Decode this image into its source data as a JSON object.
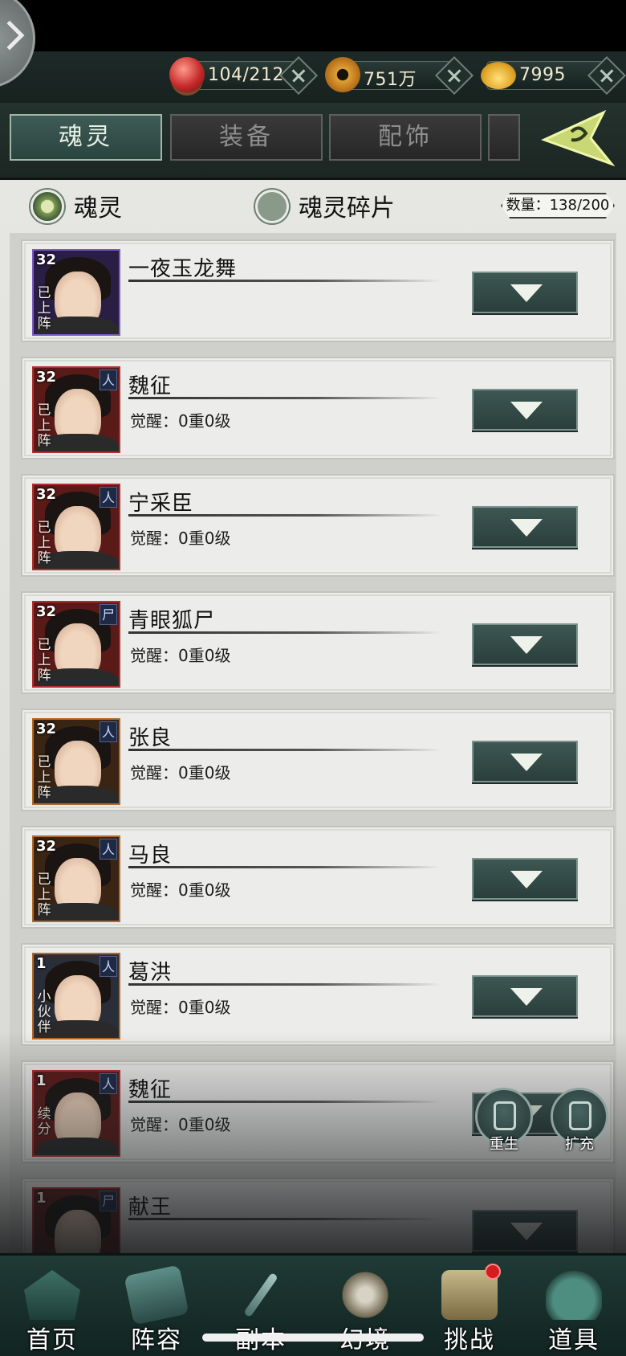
{
  "resources": [
    {
      "icon": "red-orb-icon",
      "value": "104/212"
    },
    {
      "icon": "copper-coin-icon",
      "value": "751万"
    },
    {
      "icon": "gold-ingot-icon",
      "value": "7995"
    }
  ],
  "tabs": [
    {
      "label": "魂灵",
      "active": true
    },
    {
      "label": "装备",
      "active": false
    },
    {
      "label": "配饰",
      "active": false
    }
  ],
  "filter": {
    "option_soul": "魂灵",
    "option_fragments": "魂灵碎片",
    "count": "数量：138/200"
  },
  "cards": [
    {
      "level": "32",
      "tag": "已上阵",
      "element": "",
      "name": "一夜玉龙舞",
      "awaken": "",
      "frame": "purple"
    },
    {
      "level": "32",
      "tag": "已上阵",
      "element": "人",
      "name": "魏征",
      "awaken": "觉醒：0重0级",
      "frame": "red"
    },
    {
      "level": "32",
      "tag": "已上阵",
      "element": "人",
      "name": "宁采臣",
      "awaken": "觉醒：0重0级",
      "frame": "red"
    },
    {
      "level": "32",
      "tag": "已上阵",
      "element": "尸",
      "name": "青眼狐尸",
      "awaken": "觉醒：0重0级",
      "frame": "red"
    },
    {
      "level": "32",
      "tag": "已上阵",
      "element": "人",
      "name": "张良",
      "awaken": "觉醒：0重0级",
      "frame": "orange"
    },
    {
      "level": "32",
      "tag": "已上阵",
      "element": "人",
      "name": "马良",
      "awaken": "觉醒：0重0级",
      "frame": "orange"
    },
    {
      "level": "1",
      "tag": "小伙伴",
      "element": "人",
      "name": "葛洪",
      "awaken": "觉醒：0重0级",
      "frame": "blue"
    },
    {
      "level": "1",
      "tag": "续分",
      "element": "人",
      "name": "魏征",
      "awaken": "觉醒：0重0级",
      "frame": "red"
    },
    {
      "level": "1",
      "tag": "",
      "element": "尸",
      "name": "献王",
      "awaken": "",
      "frame": "red"
    }
  ],
  "float_buttons": {
    "rebirth": "重生",
    "expand": "扩充"
  },
  "nav": [
    {
      "label": "首页",
      "icon": "home-icon"
    },
    {
      "label": "阵容",
      "icon": "lineup-icon"
    },
    {
      "label": "副本",
      "icon": "dungeon-icon"
    },
    {
      "label": "幻境",
      "icon": "illusion-icon"
    },
    {
      "label": "挑战",
      "icon": "challenge-icon"
    },
    {
      "label": "道具",
      "icon": "items-icon"
    }
  ],
  "colors": {
    "accent": "#3d5753",
    "frame_red": "#b03030",
    "frame_purple": "#7c5cc4",
    "frame_orange": "#b46a28"
  }
}
